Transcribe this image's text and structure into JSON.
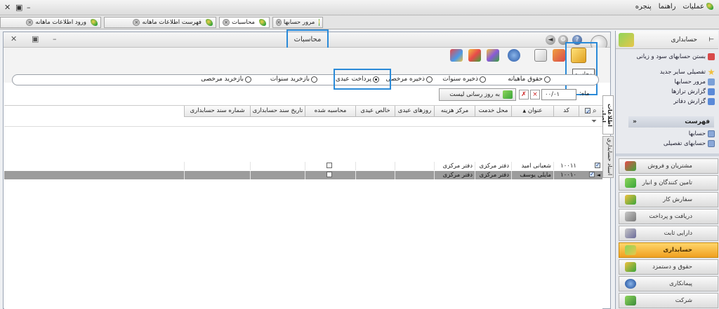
{
  "menu": {
    "items": [
      "عملیات",
      "راهنما",
      "پنجره"
    ],
    "close_glyph": "✕",
    "restore_glyph": "▣",
    "minimize_glyph": "–"
  },
  "doc_tabs": [
    "ورود اطلاعات ماهانه",
    "فهرست اطلاعات ماهانه",
    "محاسبات",
    "مرور حسابها"
  ],
  "window": {
    "title": "محاسبات",
    "close_glyph": "✕",
    "restore_glyph": "▣",
    "minimize_glyph": "–",
    "help_glyph": "?",
    "nav_glyph": "◄",
    "calc_tooltip": "محاسبه"
  },
  "calc_types": {
    "options": [
      "حقوق ماهیانه",
      "ذخیره سنوات",
      "ذخیره مرخصی",
      "پرداخت عیدی",
      "بازخرید سنوات",
      "بازخرید مرخصی"
    ],
    "selected": "پرداخت عیدی"
  },
  "filter": {
    "month_label": "ماه:",
    "month_value": "۰۰/۰۱",
    "refresh_button": "به روز رسانی لیست"
  },
  "side_tabs": [
    "اطلاعات اصلی",
    "اسناد حسابداری"
  ],
  "grid": {
    "columns": [
      "کد",
      "عنوان",
      "محل خدمت",
      "مرکز هزینه",
      "روزهای عیدی",
      "خالص عیدی",
      "محاسبه شده",
      "تاریخ سند حسابداری",
      "شماره سند حسابداری"
    ],
    "rows": [
      {
        "selected": true,
        "code": "۱۰۰۱۱",
        "title": "شعبانی امید",
        "location": "دفتر مرکزی",
        "cost_center": "دفتر مرکزی",
        "calculated": false
      },
      {
        "selected": true,
        "code": "۱۰۰۱۰",
        "title": "مایلی یوسف",
        "location": "دفتر مرکزی",
        "cost_center": "دفتر مرکزی",
        "calculated": false
      }
    ]
  },
  "right_panel": {
    "title": "حسابداری",
    "links": [
      "بستن حسابهای سود و زیانی",
      "تفصیلی سایر جدید",
      "مرور حسابها",
      "گزارش ترازها",
      "گزارش دفاتر"
    ],
    "list_section": "فهرست",
    "list_items": [
      "حسابها",
      "حسابهای تفصیلی"
    ],
    "modules": [
      "مشتریان و فروش",
      "تامین کنندگان و انبار",
      "سفارش کار",
      "دریافت و پرداخت",
      "دارایی ثابت",
      "حسابداری",
      "حقوق و دستمزد",
      "پیمانکاری",
      "شرکت"
    ],
    "active_module": "حسابداری"
  }
}
